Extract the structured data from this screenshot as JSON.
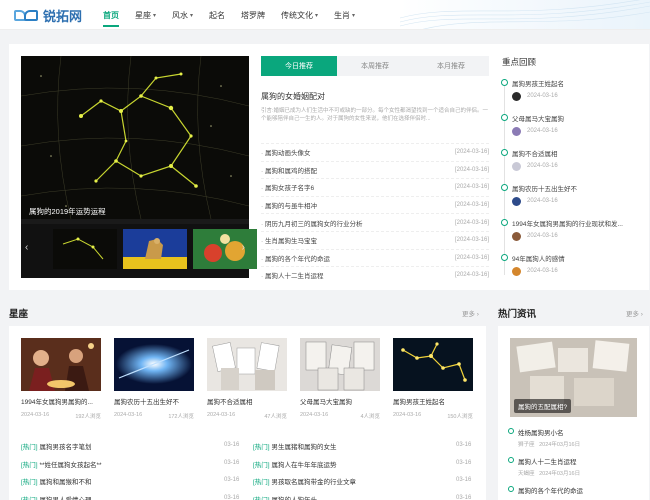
{
  "header": {
    "logo_text": "锐拓网",
    "nav": [
      {
        "label": "首页",
        "active": true,
        "caret": false
      },
      {
        "label": "星座",
        "active": false,
        "caret": true
      },
      {
        "label": "风水",
        "active": false,
        "caret": true
      },
      {
        "label": "起名",
        "active": false,
        "caret": false
      },
      {
        "label": "塔罗牌",
        "active": false,
        "caret": false
      },
      {
        "label": "传统文化",
        "active": false,
        "caret": true
      },
      {
        "label": "生肖",
        "active": false,
        "caret": true
      }
    ],
    "caret_glyph": "▾"
  },
  "slider": {
    "caption": "属狗的2019年运势运程",
    "prev_glyph": "‹",
    "next_glyph": "›"
  },
  "tabs": [
    "今日推荐",
    "本周推荐",
    "本月推荐"
  ],
  "featured": {
    "title": "属狗的女婚姻配对",
    "desc": "引言:婚姻已成为人们生活中不可或缺的一部分。每个女性都渴望找到一个适合自己的伴侣。一个能够陪伴自己一生的人。对于属狗的女性来说，他们在选择伴侣时..."
  },
  "recommend": [
    {
      "title": "属狗动画头像女",
      "date": "[2024-03-16]"
    },
    {
      "title": "属狗和属鸡的搭配",
      "date": "[2024-03-16]"
    },
    {
      "title": "属狗女孩子名字6",
      "date": "[2024-03-16]"
    },
    {
      "title": "属狗的与虽牛相冲",
      "date": "[2024-03-16]"
    },
    {
      "title": "阴历九月初三的属狗女的行业分析",
      "date": "[2024-03-16]"
    },
    {
      "title": "生肖属狗生马宝宝",
      "date": "[2024-03-16]"
    },
    {
      "title": "属狗的各个年代的命运",
      "date": "[2024-03-16]"
    },
    {
      "title": "属狗人十二生肖运程",
      "date": "[2024-03-16]"
    }
  ],
  "review": {
    "title": "重点回顾",
    "items": [
      {
        "title": "属狗男孩王姓起名",
        "date": "2024-03-16",
        "color": "#2b2b2b"
      },
      {
        "title": "父母属马大宝属狗",
        "date": "2024-03-16",
        "color": "#8b7bb5"
      },
      {
        "title": "属狗不合适属相",
        "date": "2024-03-16",
        "color": "#c9c9d6"
      },
      {
        "title": "属狗农历十五出生好不",
        "date": "2024-03-16",
        "color": "#2e4b8a"
      },
      {
        "title": "1994年女属狗男属狗的行业现状和发...",
        "date": "2024-03-16",
        "color": "#8a5a3a"
      },
      {
        "title": "94年属狗人的感情",
        "date": "2024-03-16",
        "color": "#d4862c"
      }
    ]
  },
  "xingzuo": {
    "title": "星座",
    "more": "更多 ›",
    "cards": [
      {
        "title": "1994年女属狗男属狗的...",
        "date": "2024-03-16",
        "views": "192人浏览"
      },
      {
        "title": "属狗农历十五出生好不",
        "date": "2024-03-16",
        "views": "172人浏览"
      },
      {
        "title": "属狗不合适属相",
        "date": "2024-03-16",
        "views": "47人浏览"
      },
      {
        "title": "父母属马大宝属狗",
        "date": "2024-03-16",
        "views": "4人浏览"
      },
      {
        "title": "属狗男孩王姓起名",
        "date": "2024-03-16",
        "views": "150人浏览"
      }
    ],
    "headlines_left": [
      {
        "tag": "[热门]",
        "title": "属狗男孩名字笔划",
        "date": "03-16"
      },
      {
        "tag": "[热门]",
        "title": "**姓任属狗女孩起名**",
        "date": "03-16"
      },
      {
        "tag": "[热门]",
        "title": "属狗和属猴和不和",
        "date": "03-16"
      },
      {
        "tag": "[热门]",
        "title": "属狗男人爱情心理",
        "date": "03-16"
      }
    ],
    "headlines_right": [
      {
        "tag": "[热门]",
        "title": "男生属猪和属狗的女生",
        "date": "03-16"
      },
      {
        "tag": "[热门]",
        "title": "属狗人在牛年年底运势",
        "date": "03-16"
      },
      {
        "tag": "[热门]",
        "title": "男孩取名属狗带金的行业文章",
        "date": "03-16"
      },
      {
        "tag": "[热门]",
        "title": "属狗的人狗年头",
        "date": "03-16"
      }
    ]
  },
  "hot": {
    "title": "热门资讯",
    "more": "更多 ›",
    "image_caption": "属狗的五配属相?",
    "items": [
      {
        "title": "姓杨属狗男小名",
        "author": "狮子座",
        "date": "2024年03月16日"
      },
      {
        "title": "属狗人十二生肖运程",
        "author": "天蝎座",
        "date": "2024年03月16日"
      },
      {
        "title": "属狗的各个年代的命运",
        "author": "",
        "date": ""
      }
    ]
  },
  "colors": {
    "accent": "#0aa77d",
    "logo": "#2d6fb0"
  }
}
